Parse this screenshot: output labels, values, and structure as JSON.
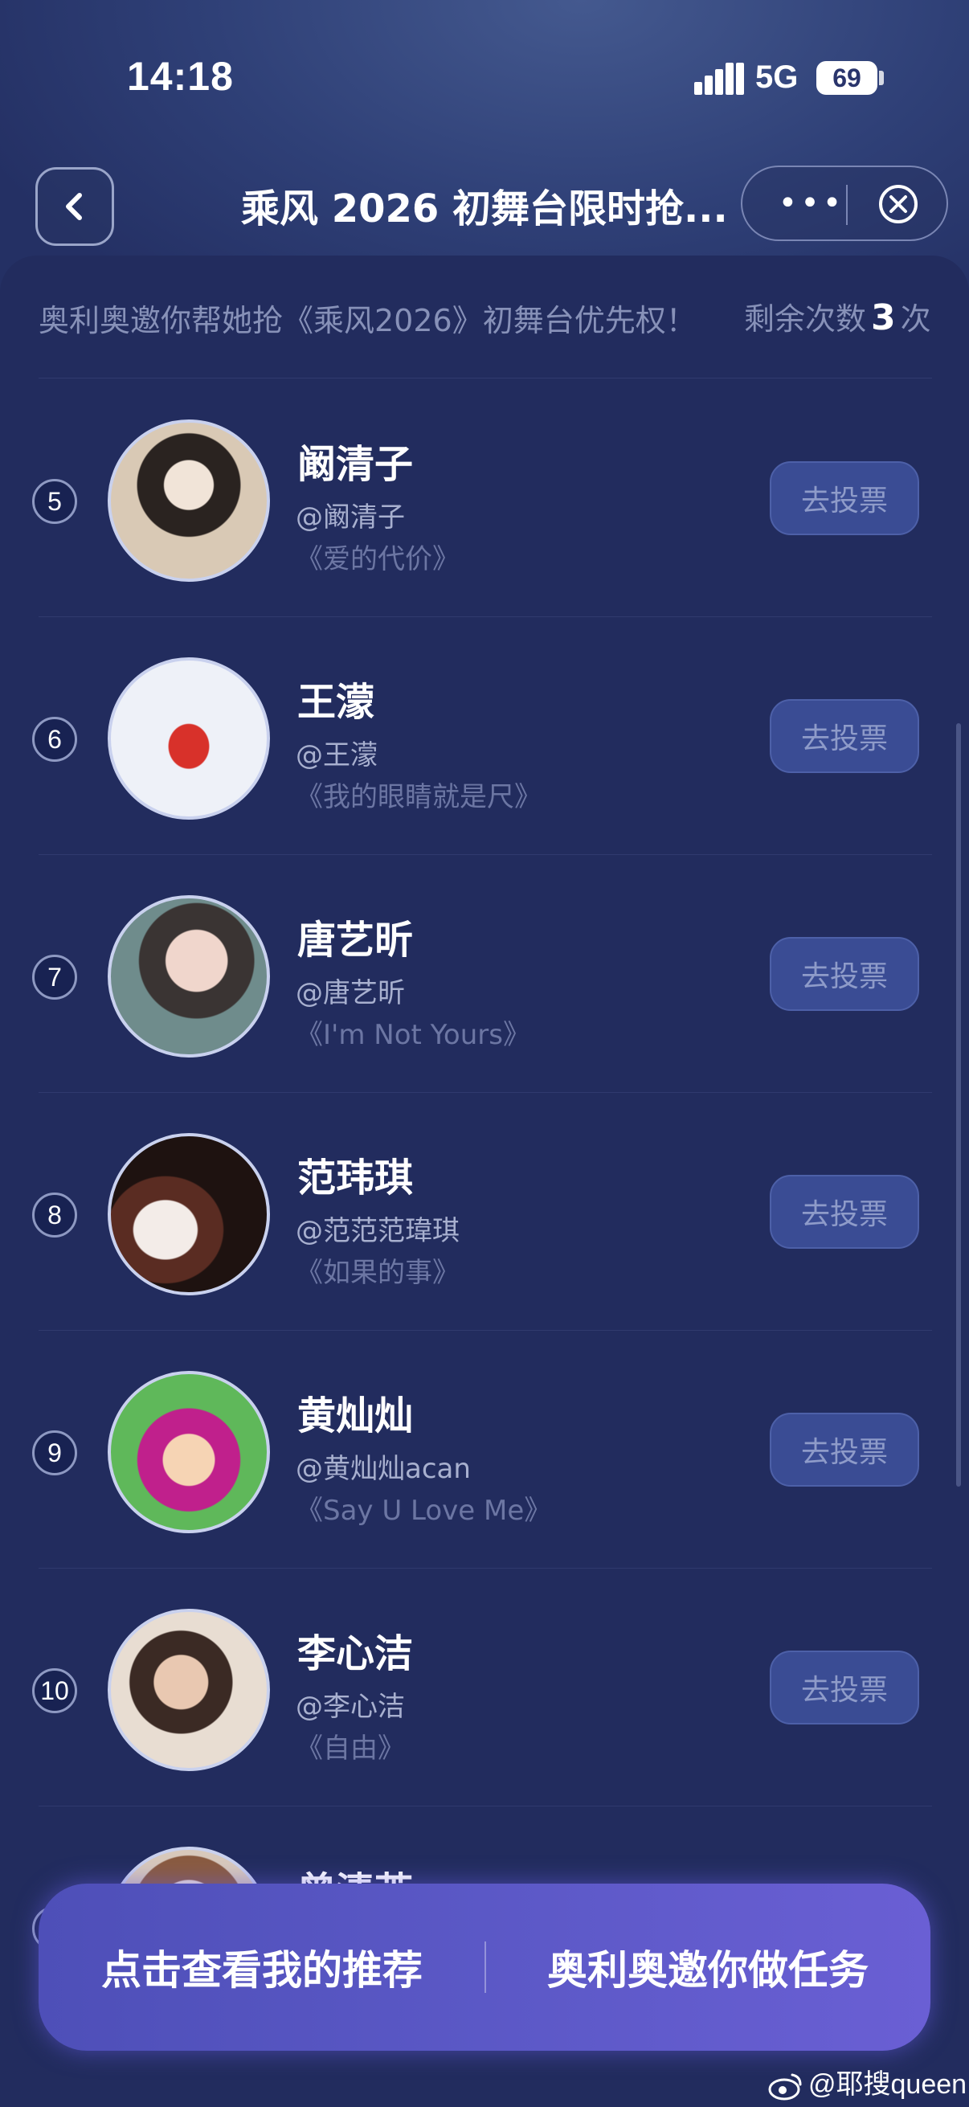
{
  "status_bar": {
    "time": "14:18",
    "network": "5G",
    "battery": "69"
  },
  "header": {
    "title": "乘风 2026 初舞台限时抢...",
    "more_label": "•••"
  },
  "notice": {
    "text": "奥利奥邀你帮她抢《乘风2026》初舞台优先权！",
    "remain_prefix": "剩余次数",
    "remain_count": "3",
    "remain_suffix": "次"
  },
  "candidates": [
    {
      "rank": "5",
      "name": "阚清子",
      "handle": "@阚清子",
      "song": "《爱的代价》",
      "vote_label": "去投票",
      "avatar_color": "#c9b8a7"
    },
    {
      "rank": "6",
      "name": "王濛",
      "handle": "@王濛",
      "song": "《我的眼睛就是尺》",
      "vote_label": "去投票",
      "avatar_color": "#eef1f8"
    },
    {
      "rank": "7",
      "name": "唐艺昕",
      "handle": "@唐艺昕",
      "song": "《I'm Not Yours》",
      "vote_label": "去投票",
      "avatar_color": "#6f8c8c"
    },
    {
      "rank": "8",
      "name": "范玮琪",
      "handle": "@范范范瑋琪",
      "song": "《如果的事》",
      "vote_label": "去投票",
      "avatar_color": "#2b1a16"
    },
    {
      "rank": "9",
      "name": "黄灿灿",
      "handle": "@黄灿灿acan",
      "song": "《Say U Love Me》",
      "vote_label": "去投票",
      "avatar_color": "#5fb85a"
    },
    {
      "rank": "10",
      "name": "李心洁",
      "handle": "@李心洁",
      "song": "《自由》",
      "vote_label": "去投票",
      "avatar_color": "#e8ddd2"
    },
    {
      "rank": "",
      "name": "曾清芮",
      "handle": "",
      "song": "",
      "vote_label": "",
      "avatar_color": "#d8c9bb"
    }
  ],
  "bottom_bar": {
    "left_label": "点击查看我的推荐",
    "right_label": "奥利奥邀你做任务"
  },
  "watermark": "@耶搜queen"
}
